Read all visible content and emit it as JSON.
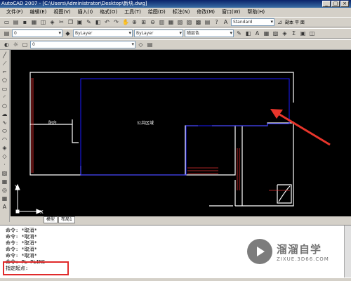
{
  "window": {
    "title": "AutoCAD 2007 - [C:\\Users\\Administrator\\Desktop\\新块.dwg]"
  },
  "menu": [
    "文件(F)",
    "编辑(E)",
    "视图(V)",
    "插入(I)",
    "格式(O)",
    "工具(T)",
    "绘图(D)",
    "标注(N)",
    "修改(M)",
    "窗口(W)",
    "帮助(H)"
  ],
  "toolbar": {
    "text_style": "Standard",
    "right_labels": [
      "副本",
      "平 面"
    ],
    "layer": "0",
    "linetype_1": "ByLayer",
    "linetype_2": "ByLayer",
    "color": "随层色",
    "layer_state": "0"
  },
  "drawing": {
    "room_left": "阳台",
    "room_center": "公共区域",
    "axis_x": "X",
    "axis_y": "Y"
  },
  "tabs": [
    "模型",
    "布局1"
  ],
  "command": {
    "lines": [
      "命令: *取消*",
      "命令: *取消*",
      "命令: *取消*",
      "命令: *取消*",
      "命令: *取消*",
      "命令: PL PLINE",
      "指定起点:"
    ]
  },
  "watermark": {
    "name": "溜溜自学",
    "url": "ZIXUE.3D66.COM"
  },
  "colors": {
    "canvas": "#000000",
    "walls": "#ffffff",
    "room_outline": "#1a1aff",
    "arrow": "#e8352b",
    "highlight": "#e02a2a"
  }
}
